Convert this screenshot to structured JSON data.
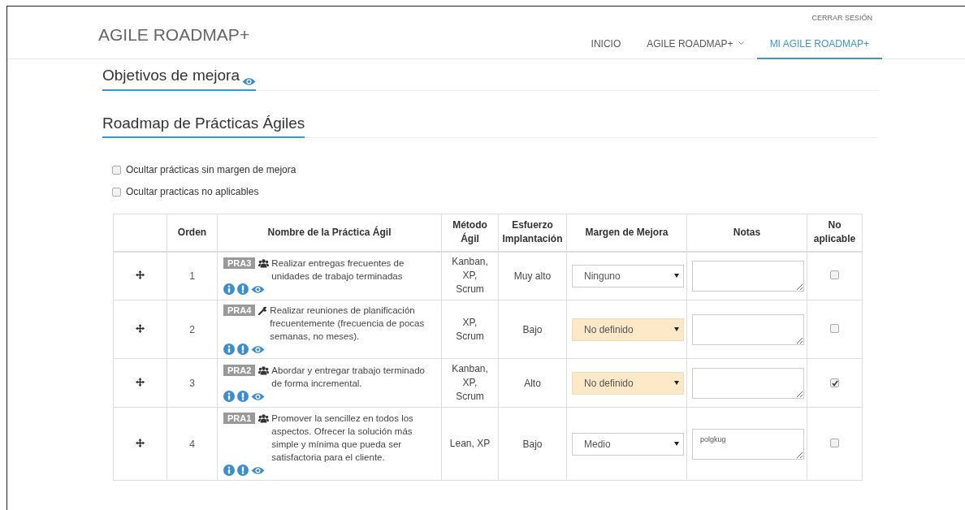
{
  "header": {
    "brand": "AGILE ROADMAP+",
    "logout": "CERRAR SESIÓN",
    "nav": [
      {
        "label": "INICIO",
        "selected": false,
        "dropdown": false
      },
      {
        "label": "AGILE ROADMAP+",
        "selected": false,
        "dropdown": true
      },
      {
        "label": "MI AGILE ROADMAP+",
        "selected": true,
        "dropdown": false
      }
    ]
  },
  "sections": [
    "Objetivos de mejora",
    "Roadmap de Prácticas Ágiles"
  ],
  "filters": [
    {
      "label": "Ocultar prácticas sin margen de mejora",
      "checked": false
    },
    {
      "label": "Ocultar practicas no aplicables",
      "checked": false
    }
  ],
  "table": {
    "columns": [
      "",
      "Orden",
      "Nombre de la Práctica Ágil",
      "Método Ágil",
      "Esfuerzo Implantación",
      "Margen de Mejora",
      "Notas",
      "No aplicable"
    ],
    "rows": [
      {
        "order": "1",
        "code": "PRA3",
        "kind": "group",
        "name": "Realizar entregas frecuentes de unidades de trabajo terminadas",
        "method": "Kanban, XP, Scrum",
        "effort": "Muy alto",
        "margin": "Ninguno",
        "margin_undefined": false,
        "notes": "",
        "not_applicable": false
      },
      {
        "order": "2",
        "code": "PRA4",
        "kind": "wrench",
        "name": "Realizar reuniones de planificación frecuentemente (frecuencia de pocas semanas, no meses).",
        "method": "XP, Scrum",
        "effort": "Bajo",
        "margin": "No definido",
        "margin_undefined": true,
        "notes": "",
        "not_applicable": false
      },
      {
        "order": "3",
        "code": "PRA2",
        "kind": "group",
        "name": "Abordar y entregar trabajo terminado de forma incremental.",
        "method": "Kanban, XP, Scrum",
        "effort": "Alto",
        "margin": "No definido",
        "margin_undefined": true,
        "notes": "",
        "not_applicable": true
      },
      {
        "order": "4",
        "code": "PRA1",
        "kind": "group",
        "name": "Promover la sencillez en todos los aspectos. Ofrecer la solución más simple y mínima que pueda ser satisfactoria para el cliente.",
        "method": "Lean, XP",
        "effort": "Bajo",
        "margin": "Medio",
        "margin_undefined": false,
        "notes": "polgkug",
        "not_applicable": false
      }
    ]
  }
}
